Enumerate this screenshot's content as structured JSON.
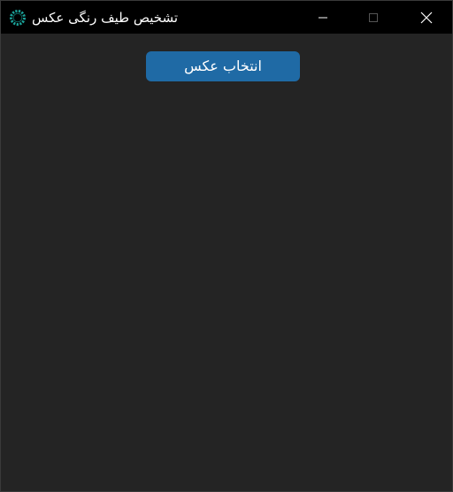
{
  "window": {
    "title": "تشخیص طیف رنگی عکس",
    "icon": "ring-logo-icon",
    "controls": {
      "minimize_icon": "minimize-icon",
      "maximize_icon": "maximize-icon",
      "close_icon": "close-icon"
    }
  },
  "main": {
    "select_image_label": "انتخاب عکس"
  },
  "colors": {
    "background": "#242424",
    "titlebar": "#000000",
    "button": "#1f6aa5",
    "icon_accent": "#1aa198"
  }
}
